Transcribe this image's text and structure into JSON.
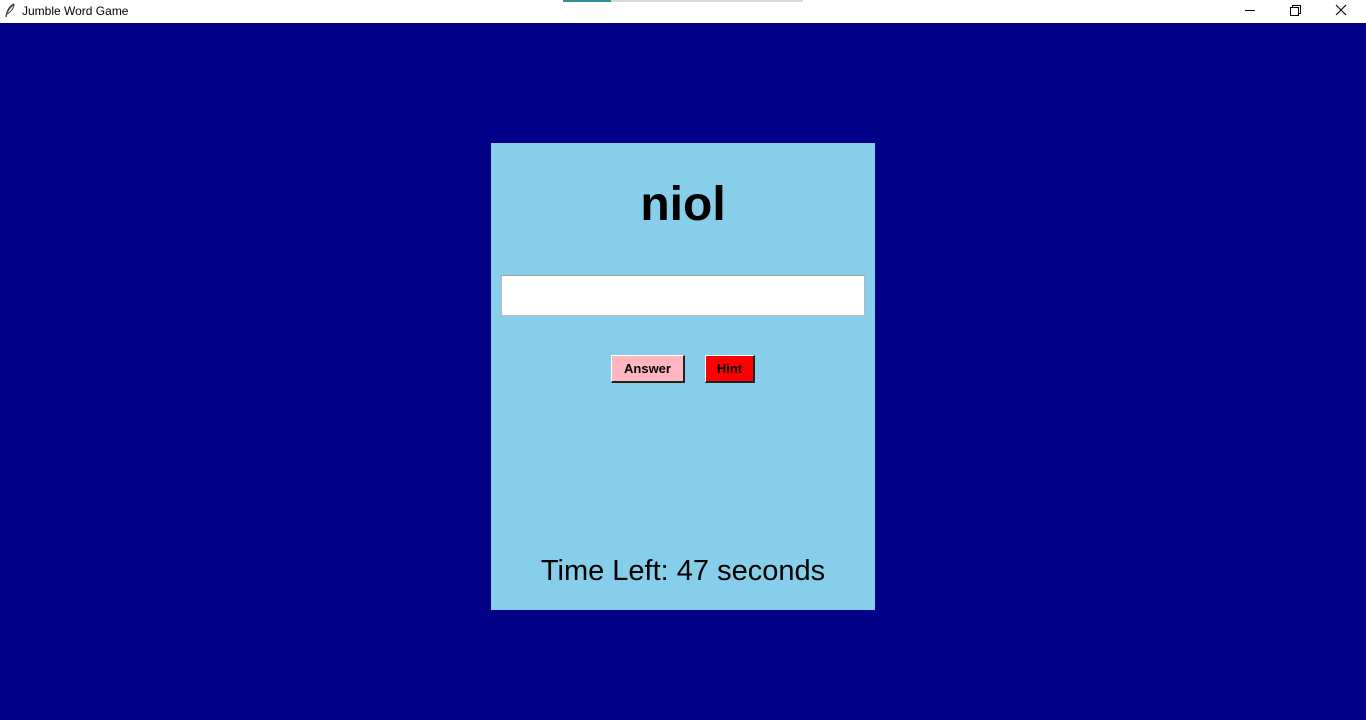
{
  "window": {
    "title": "Jumble Word Game",
    "background_color": "#000088"
  },
  "titlebar": {
    "progress_fraction": 0.2,
    "progress_color": "#2f8f9a"
  },
  "game": {
    "card_color": "#87ceeb",
    "scrambled_word": "niol",
    "answer_input_value": "",
    "answer_button_label": "Answer",
    "answer_button_color": "#ffb6c1",
    "hint_button_label": "Hint",
    "hint_button_color": "#ff0000",
    "time_left_text": "Time Left: 47 seconds"
  }
}
